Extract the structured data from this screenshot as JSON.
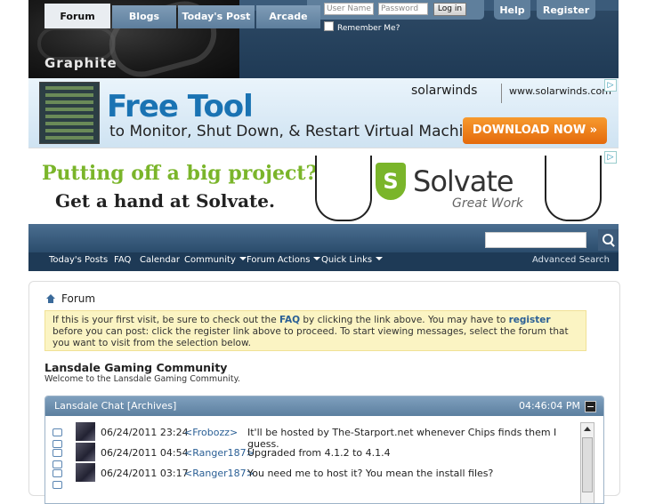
{
  "header": {
    "logo_text": "Graphite",
    "login": {
      "username_placeholder": "User Name",
      "password_placeholder": "Password",
      "login_button": "Log in",
      "remember_label": "Remember Me?"
    },
    "help_button": "Help",
    "register_button": "Register"
  },
  "ads": {
    "ad1": {
      "headline": "Free Tool",
      "subline": "to Monitor, Shut Down, & Restart Virtual Machines",
      "brand": "solarwinds",
      "url": "www.solarwinds.com",
      "cta": "DOWNLOAD NOW »"
    },
    "ad2": {
      "line1": "Putting off a big project?",
      "line2": "Get a hand at Solvate.",
      "brand": "Solvate",
      "tagline": "Great Work",
      "shield_letter": "S"
    }
  },
  "nav": {
    "tabs": [
      {
        "label": "Forum",
        "active": true
      },
      {
        "label": "Blogs"
      },
      {
        "label": "Today's Post"
      },
      {
        "label": "Arcade"
      }
    ],
    "subnav": {
      "items": [
        "Today's Posts",
        "FAQ",
        "Calendar",
        "Community",
        "Forum Actions",
        "Quick Links"
      ],
      "advanced_search": "Advanced Search"
    }
  },
  "content": {
    "breadcrumb": "Forum",
    "notice": {
      "p1": "If this is your first visit, be sure to check out the ",
      "faq_link": "FAQ",
      "p2": " by clicking the link above. You may have to ",
      "register_link": "register",
      "p3": " before you can post: click the register link above to proceed. To start viewing messages, select the forum that you want to visit from the selection below."
    },
    "forum_title": "Lansdale Gaming Community",
    "forum_desc": "Welcome to the Lansdale Gaming Community.",
    "chat": {
      "title": "Lansdale Chat",
      "archives": "[Archives]",
      "time": "04:46:04 PM",
      "messages": [
        {
          "date": "06/24/2011 23:24",
          "user": "<Frobozz>",
          "text": "It'll be hosted by The-Starport.net whenever Chips finds them I guess."
        },
        {
          "date": "06/24/2011 04:54",
          "user": "<Ranger187>",
          "text": "Upgraded from 4.1.2 to 4.1.4"
        },
        {
          "date": "06/24/2011 03:17",
          "user": "<Ranger187>",
          "text": "You need me to host it? You mean the install files?"
        }
      ]
    }
  }
}
